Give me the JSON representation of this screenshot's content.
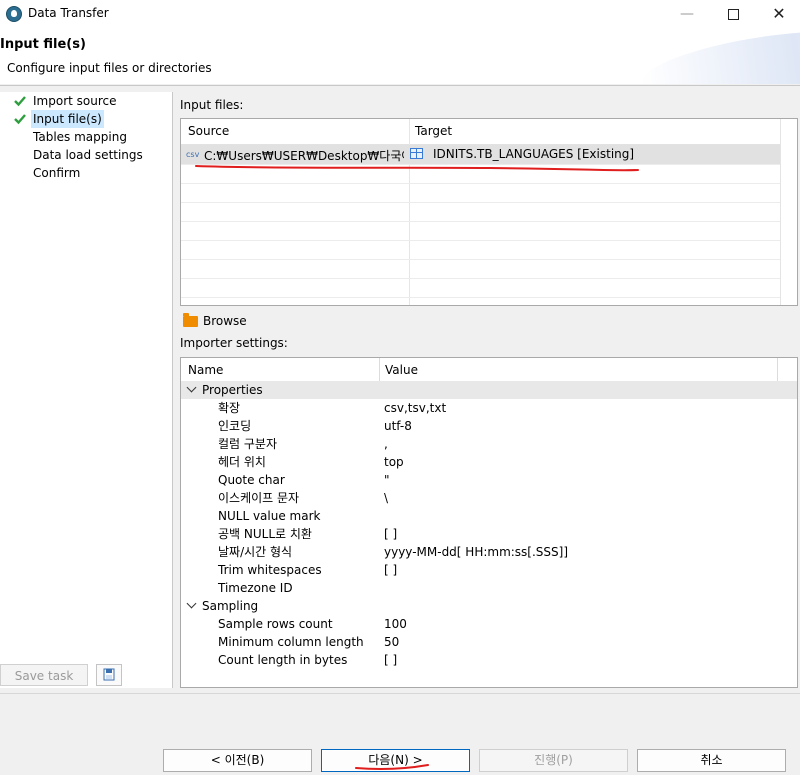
{
  "window": {
    "title": "Data Transfer"
  },
  "header": {
    "title": "Input file(s)",
    "description": "Configure input files or directories"
  },
  "nav": {
    "items": [
      {
        "label": "Import source",
        "checked": true,
        "active": false
      },
      {
        "label": "Input file(s)",
        "checked": true,
        "active": true
      },
      {
        "label": "Tables mapping",
        "checked": false,
        "active": false
      },
      {
        "label": "Data load settings",
        "checked": false,
        "active": false
      },
      {
        "label": "Confirm",
        "checked": false,
        "active": false
      }
    ],
    "save_task_label": "Save task"
  },
  "input_files": {
    "label": "Input files:",
    "columns": [
      "Source",
      "Target"
    ],
    "rows": [
      {
        "source": "C:₩Users₩USER₩Desktop₩다국어...",
        "target": "IDNITS.TB_LANGUAGES [Existing]",
        "source_icon_text": "csv"
      }
    ]
  },
  "browse": {
    "label": "Browse"
  },
  "importer_settings": {
    "label": "Importer settings:",
    "columns": [
      "Name",
      "Value"
    ],
    "groups": [
      {
        "name": "Properties",
        "rows": [
          {
            "name": "확장",
            "value": "csv,tsv,txt"
          },
          {
            "name": "인코딩",
            "value": "utf-8"
          },
          {
            "name": "컬럼 구분자",
            "value": ","
          },
          {
            "name": "헤더 위치",
            "value": "top"
          },
          {
            "name": "Quote char",
            "value": "\""
          },
          {
            "name": "이스케이프 문자",
            "value": "\\"
          },
          {
            "name": "NULL value mark",
            "value": ""
          },
          {
            "name": "공백 NULL로 치환",
            "value": "[  ]"
          },
          {
            "name": "날짜/시간 형식",
            "value": "yyyy-MM-dd[ HH:mm:ss[.SSS]]"
          },
          {
            "name": "Trim whitespaces",
            "value": "[  ]"
          },
          {
            "name": "Timezone ID",
            "value": ""
          }
        ]
      },
      {
        "name": "Sampling",
        "rows": [
          {
            "name": "Sample rows count",
            "value": "100"
          },
          {
            "name": "Minimum column length",
            "value": "50"
          },
          {
            "name": "Count length in bytes",
            "value": "[  ]"
          }
        ]
      }
    ]
  },
  "buttons": {
    "back": "< 이전(B)",
    "next": "다음(N) >",
    "proceed": "진행(P)",
    "cancel": "취소"
  },
  "colors": {
    "check": "#2e9e3e",
    "selection": "#cce8ff",
    "annotation": "#e01e1e",
    "folder": "#f08c00"
  }
}
